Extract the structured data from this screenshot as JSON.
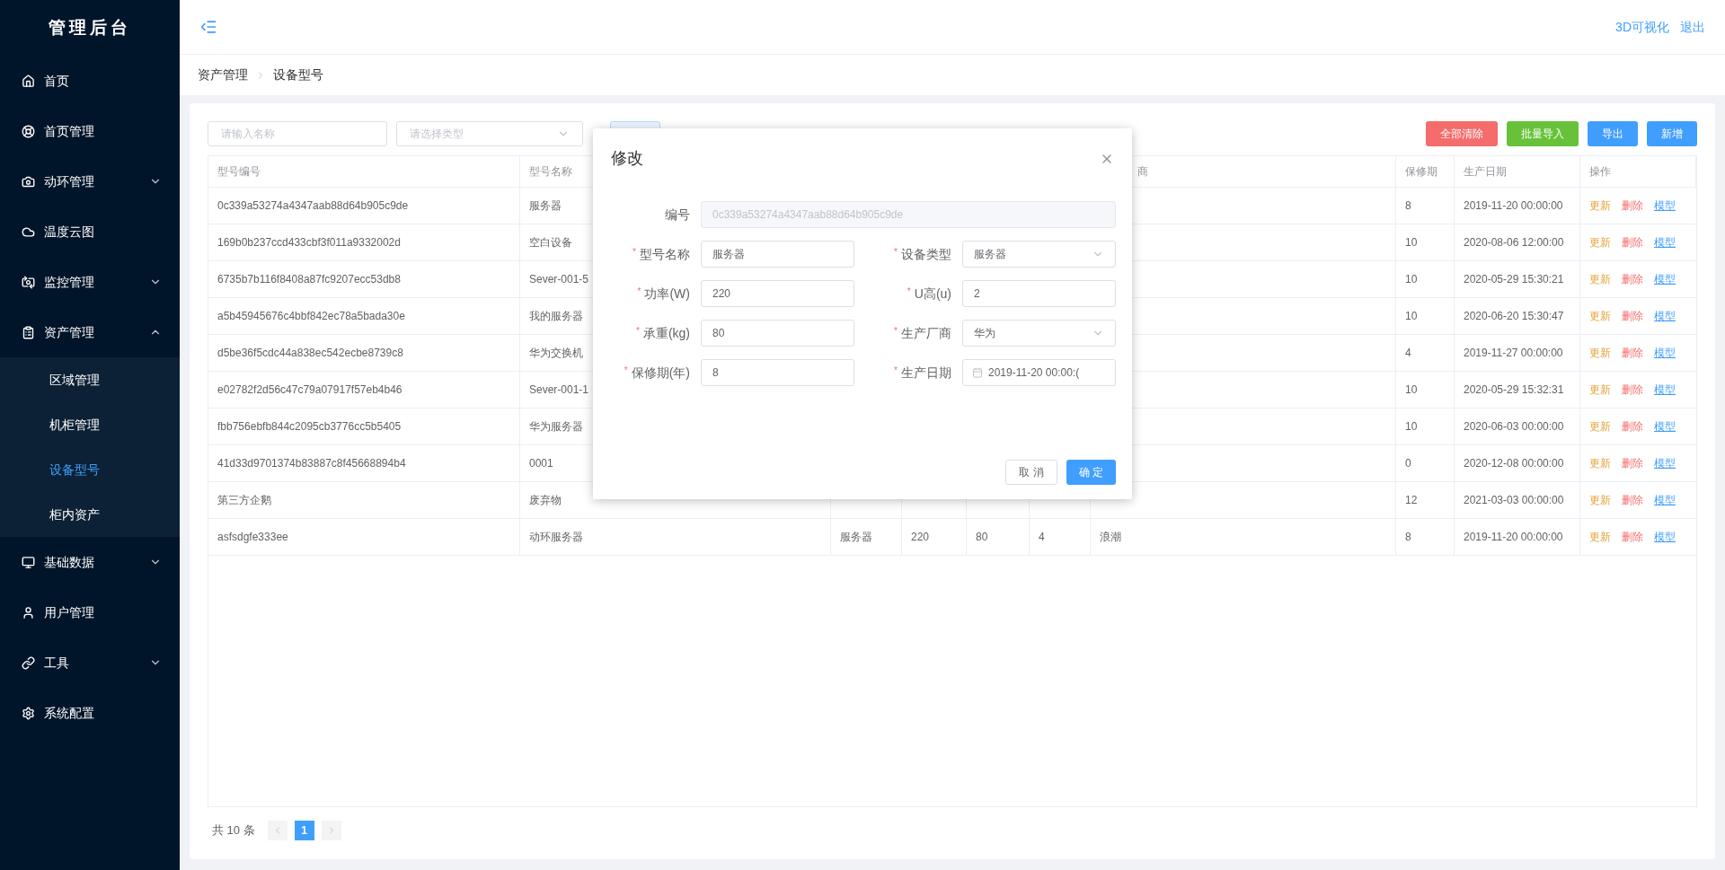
{
  "sidebar": {
    "title": "管理后台",
    "items": [
      {
        "label": "首页",
        "expandable": false
      },
      {
        "label": "首页管理",
        "expandable": false
      },
      {
        "label": "动环管理",
        "expandable": true,
        "expanded": false
      },
      {
        "label": "温度云图",
        "expandable": false
      },
      {
        "label": "监控管理",
        "expandable": true,
        "expanded": false
      },
      {
        "label": "资产管理",
        "expandable": true,
        "expanded": true,
        "children": [
          {
            "label": "区域管理",
            "selected": false
          },
          {
            "label": "机柜管理",
            "selected": false
          },
          {
            "label": "设备型号",
            "selected": true
          },
          {
            "label": "柜内资产",
            "selected": false
          }
        ]
      },
      {
        "label": "基础数据",
        "expandable": true,
        "expanded": false
      },
      {
        "label": "用户管理",
        "expandable": false
      },
      {
        "label": "工具",
        "expandable": true,
        "expanded": false
      },
      {
        "label": "系统配置",
        "expandable": false
      }
    ]
  },
  "header": {
    "links": [
      "3D可视化",
      "退出"
    ]
  },
  "breadcrumb": [
    "资产管理",
    "设备型号"
  ],
  "toolbar": {
    "name_placeholder": "请输入名称",
    "type_placeholder": "请选择类型",
    "buttons": [
      {
        "label": "全部清除",
        "kind": "danger"
      },
      {
        "label": "批量导入",
        "kind": "success"
      },
      {
        "label": "导出",
        "kind": "primary"
      },
      {
        "label": "新增",
        "kind": "primary"
      }
    ]
  },
  "table": {
    "columns": [
      "型号编号",
      "型号名称",
      "",
      "",
      "",
      "",
      "商",
      "保修期",
      "生产日期",
      "操作"
    ],
    "rows": [
      {
        "cells": [
          "0c339a53274a4347aab88d64b905c9de",
          "服务器",
          null,
          null,
          null,
          null,
          null,
          "8",
          "2019-11-20 00:00:00"
        ],
        "actions": [
          {
            "label": "更新",
            "kind": "update"
          },
          {
            "label": "删除",
            "kind": "delete"
          },
          {
            "label": "模型",
            "kind": "model"
          }
        ]
      },
      {
        "cells": [
          "169b0b237ccd433cbf3f011a9332002d",
          "空白设备",
          null,
          null,
          null,
          null,
          null,
          "10",
          "2020-08-06 12:00:00"
        ],
        "actions": [
          {
            "label": "更新",
            "kind": "update"
          },
          {
            "label": "删除",
            "kind": "delete"
          },
          {
            "label": "模型",
            "kind": "model"
          }
        ]
      },
      {
        "cells": [
          "6735b7b116f8408a87fc9207ecc53db8",
          "Sever-001-5",
          null,
          null,
          null,
          null,
          null,
          "10",
          "2020-05-29 15:30:21"
        ],
        "actions": [
          {
            "label": "更新",
            "kind": "update"
          },
          {
            "label": "删除",
            "kind": "delete"
          },
          {
            "label": "模型",
            "kind": "model"
          }
        ]
      },
      {
        "cells": [
          "a5b45945676c4bbf842ec78a5bada30e",
          "我的服务器",
          null,
          null,
          null,
          null,
          null,
          "10",
          "2020-06-20 15:30:47"
        ],
        "actions": [
          {
            "label": "更新",
            "kind": "update"
          },
          {
            "label": "删除",
            "kind": "delete"
          },
          {
            "label": "模型",
            "kind": "model"
          }
        ]
      },
      {
        "cells": [
          "d5be36f5cdc44a838ec542ecbe8739c8",
          "华为交换机",
          null,
          null,
          null,
          null,
          null,
          "4",
          "2019-11-27 00:00:00"
        ],
        "actions": [
          {
            "label": "更新",
            "kind": "update"
          },
          {
            "label": "删除",
            "kind": "delete"
          },
          {
            "label": "模型",
            "kind": "model"
          }
        ]
      },
      {
        "cells": [
          "e02782f2d56c47c79a07917f57eb4b46",
          "Sever-001-1",
          null,
          null,
          null,
          null,
          null,
          "10",
          "2020-05-29 15:32:31"
        ],
        "actions": [
          {
            "label": "更新",
            "kind": "update"
          },
          {
            "label": "删除",
            "kind": "delete"
          },
          {
            "label": "模型",
            "kind": "model"
          }
        ]
      },
      {
        "cells": [
          "fbb756ebfb844c2095cb3776cc5b5405",
          "华为服务器",
          null,
          null,
          null,
          null,
          null,
          "10",
          "2020-06-03 00:00:00"
        ],
        "actions": [
          {
            "label": "更新",
            "kind": "update"
          },
          {
            "label": "删除",
            "kind": "delete"
          },
          {
            "label": "模型",
            "kind": "model"
          }
        ]
      },
      {
        "cells": [
          "41d33d9701374b83887c8f45668894b4",
          "0001",
          null,
          null,
          null,
          null,
          null,
          "0",
          "2020-12-08 00:00:00"
        ],
        "actions": [
          {
            "label": "更新",
            "kind": "update"
          },
          {
            "label": "删除",
            "kind": "delete"
          },
          {
            "label": "模型",
            "kind": "model"
          }
        ]
      },
      {
        "cells": [
          "第三方企鹅",
          "废弃物",
          null,
          null,
          null,
          null,
          null,
          "12",
          "2021-03-03 00:00:00"
        ],
        "actions": [
          {
            "label": "更新",
            "kind": "update"
          },
          {
            "label": "删除",
            "kind": "delete"
          },
          {
            "label": "模型",
            "kind": "model"
          }
        ]
      },
      {
        "cells": [
          "asfsdgfe333ee",
          "动环服务器",
          "服务器",
          "220",
          "80",
          "4",
          "浪潮",
          "8",
          "2019-11-20 00:00:00"
        ],
        "actions": [
          {
            "label": "更新",
            "kind": "update"
          },
          {
            "label": "删除",
            "kind": "delete"
          },
          {
            "label": "模型",
            "kind": "model"
          }
        ]
      }
    ]
  },
  "pagination": {
    "total": "共 10 条",
    "pages": [
      {
        "label": "1",
        "selected": true
      }
    ]
  },
  "dialog": {
    "title": "修改",
    "fields": [
      {
        "label": "编号",
        "value": "0c339a53274a4347aab88d64b905c9de",
        "kind": "readonly"
      },
      {
        "marker": "*",
        "label": "型号名称",
        "value": "服务器",
        "kind": "input"
      },
      {
        "marker": "*",
        "label": "设备类型",
        "value": "服务器",
        "kind": "select"
      },
      {
        "marker": "*",
        "label": "功率(W)",
        "value": "220",
        "kind": "input"
      },
      {
        "marker": "*",
        "label": "U高(u)",
        "value": "2",
        "kind": "input"
      },
      {
        "marker": "*",
        "label": "承重(kg)",
        "value": "80",
        "kind": "input"
      },
      {
        "marker": "*",
        "label": "生产厂商",
        "value": "华为",
        "kind": "select"
      },
      {
        "marker": "*",
        "label": "保修期(年)",
        "value": "8",
        "kind": "input"
      },
      {
        "marker": "*",
        "label": "生产日期",
        "value": "2019-11-20 00:00:(",
        "kind": "date"
      }
    ],
    "buttons": [
      {
        "label": "取 消",
        "kind": "default"
      },
      {
        "label": "确 定",
        "kind": "primary"
      }
    ]
  }
}
